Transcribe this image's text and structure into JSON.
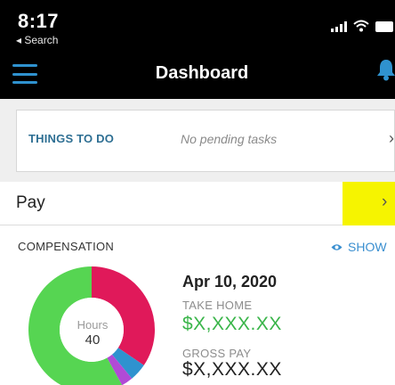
{
  "status_bar": {
    "time": "8:17",
    "back_label": "◂ Search",
    "icons": [
      "signal-icon",
      "wifi-icon",
      "battery-icon"
    ]
  },
  "nav": {
    "title": "Dashboard",
    "menu_icon": "hamburger-menu-icon",
    "notification_icon": "bell-icon"
  },
  "todo": {
    "title": "THINGS TO DO",
    "status": "No pending tasks",
    "chevron": "›"
  },
  "pay": {
    "label": "Pay",
    "chevron": "›"
  },
  "compensation": {
    "label": "COMPENSATION",
    "show_label": "SHOW",
    "show_icon": "eye-icon",
    "hours_label": "Hours",
    "hours_value": "40",
    "date": "Apr 10, 2020",
    "take_home_label": "TAKE HOME",
    "take_home_value": "$X,XXX.XX",
    "gross_label": "GROSS PAY",
    "gross_value": "$X,XXX.XX",
    "chart_segments": [
      {
        "share": 0.345,
        "color": "#e0195a"
      },
      {
        "share": 0.045,
        "color": "#2f92cf"
      },
      {
        "share": 0.03,
        "color": "#b14ad6"
      },
      {
        "share": 0.58,
        "color": "#56d552"
      }
    ],
    "colors": {
      "take_home": "#3ab54a",
      "accent": "#2f92cf",
      "highlight": "#f6f400"
    }
  }
}
